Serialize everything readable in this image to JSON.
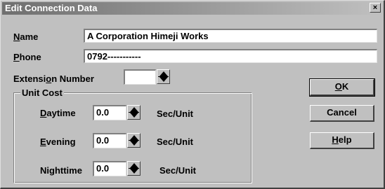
{
  "window": {
    "title": "Edit Connection Data",
    "close_label": "×"
  },
  "name": {
    "label_mn": "N",
    "label_rest": "ame",
    "value": "A Corporation Himeji Works"
  },
  "phone": {
    "label_mn": "P",
    "label_rest": "hone",
    "value": "0792-----------"
  },
  "extension": {
    "label_pre": "Extensi",
    "label_mn": "o",
    "label_post": "n Number",
    "value": ""
  },
  "unit_cost": {
    "title": "Unit Cost",
    "unit_suffix": "Sec/Unit",
    "daytime": {
      "label_mn": "D",
      "label_rest": "aytime",
      "value": "0.0"
    },
    "evening": {
      "label_mn": "E",
      "label_rest": "vening",
      "value": "0.0"
    },
    "nighttime": {
      "label_pre": "Ni",
      "label_mn": "g",
      "label_post": "httime",
      "value": "0.0"
    }
  },
  "buttons": {
    "ok_mn": "O",
    "ok_rest": "K",
    "cancel": "Cancel",
    "help_mn": "H",
    "help_rest": "elp"
  }
}
